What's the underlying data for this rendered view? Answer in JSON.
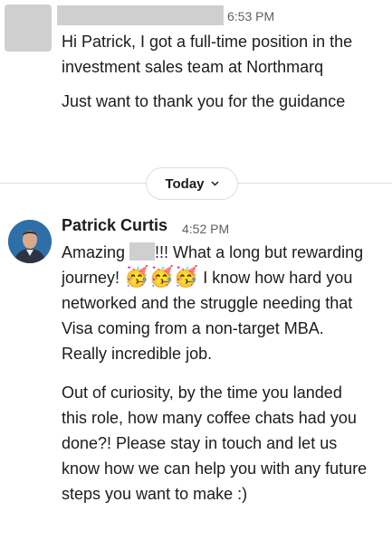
{
  "first_message": {
    "time": "6:53 PM",
    "paragraphs": [
      "Hi Patrick, I got a full-time position in the investment sales team at Northmarq",
      "Just want to thank you for the guidance"
    ]
  },
  "day_divider": {
    "label": "Today",
    "chevron": "chevron-down-icon"
  },
  "second_message": {
    "author": "Patrick Curtis",
    "time": "4:52 PM",
    "p1_start": "Amazing ",
    "p1_after_name": "!!!  What a long but rewarding journey! ",
    "emoji": "🥳🥳🥳",
    "p1_end": "  I know how hard you networked and the struggle needing that Visa coming from a non-target MBA.  Really incredible job.",
    "p2": "Out of curiosity, by the time you landed this role, how many coffee chats had you done?!   Please stay in touch and let us know how we can help you with any future steps you want to make :)"
  },
  "colors": {
    "text": "#1d1c1d",
    "timestamp": "#616061",
    "redaction": "#cfcfcf",
    "divider": "#dddddd"
  }
}
